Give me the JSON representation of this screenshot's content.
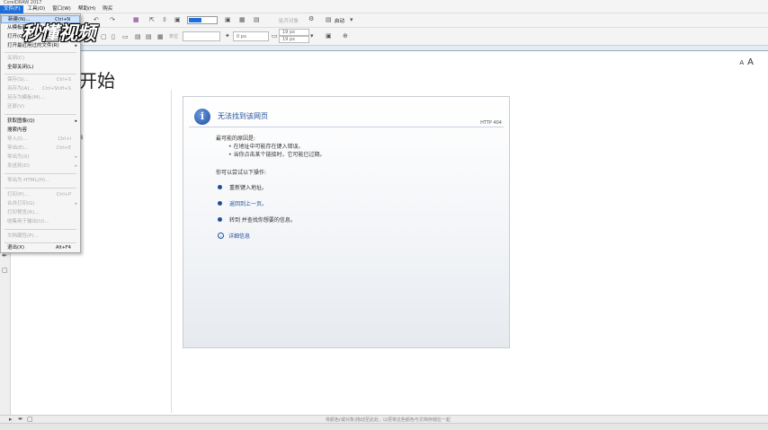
{
  "app": {
    "title": "CorelDRAW 2017"
  },
  "menubar": {
    "items": [
      "文件(F)",
      "工具(O)",
      "窗口(W)",
      "帮助(H)",
      "购买"
    ]
  },
  "toolbar": {
    "zoom_label": "启动",
    "x_value": "0 px",
    "nudge_x": "19 px",
    "nudge_y": "19 px",
    "unit_label": "单位",
    "snap_label": "贴齐对象"
  },
  "watermark": "秒懂视频",
  "page": {
    "title": "开始",
    "partial_text": "档",
    "font_small": "A",
    "font_large": "A"
  },
  "error": {
    "title": "无法找到该网页",
    "code": "HTTP 404",
    "causes_heading": "最可能的原因是:",
    "causes": [
      "在地址中可能存在键入错误。",
      "当你点击某个链接时，它可能已过期。"
    ],
    "actions_heading": "你可以尝试以下操作:",
    "actions": [
      "重新键入地址。",
      "返回到上一页。",
      "转到  并查找你想要的信息。"
    ],
    "details": "详细信息"
  },
  "filemenu": {
    "items": [
      {
        "label": "新建(N)...",
        "shortcut": "Ctrl+N",
        "enabled": true
      },
      {
        "label": "从模板新建(F)...",
        "shortcut": "",
        "enabled": true
      },
      {
        "label": "打开(O)...",
        "shortcut": "Ctrl+O",
        "enabled": true
      },
      {
        "label": "打开最近用过的文件(R)",
        "shortcut": "",
        "enabled": true
      },
      {
        "label": "关闭(C)",
        "shortcut": "",
        "enabled": false
      },
      {
        "label": "全部关闭(L)",
        "shortcut": "",
        "enabled": true
      },
      {
        "label": "保存(S)...",
        "shortcut": "Ctrl+S",
        "enabled": false
      },
      {
        "label": "另存为(A)...",
        "shortcut": "Ctrl+Shift+S",
        "enabled": false
      },
      {
        "label": "另存为模板(M)...",
        "shortcut": "",
        "enabled": false
      },
      {
        "label": "还原(V)",
        "shortcut": "",
        "enabled": false
      },
      {
        "label": "获取图像(Q)",
        "shortcut": "",
        "enabled": true
      },
      {
        "label": "搜索内容",
        "shortcut": "",
        "enabled": true
      },
      {
        "label": "导入(I)...",
        "shortcut": "Ctrl+I",
        "enabled": false
      },
      {
        "label": "导出(E)...",
        "shortcut": "Ctrl+E",
        "enabled": false
      },
      {
        "label": "导出为(X)",
        "shortcut": "",
        "enabled": false
      },
      {
        "label": "发送到(D)",
        "shortcut": "",
        "enabled": false
      },
      {
        "label": "导出为 HTML(H)...",
        "shortcut": "",
        "enabled": false
      },
      {
        "label": "打印(P)...",
        "shortcut": "Ctrl+P",
        "enabled": false
      },
      {
        "label": "合并打印(G)",
        "shortcut": "",
        "enabled": false
      },
      {
        "label": "打印预览(R)...",
        "shortcut": "",
        "enabled": false
      },
      {
        "label": "收集用于输出(U)...",
        "shortcut": "",
        "enabled": false
      },
      {
        "label": "文档属性(P)...",
        "shortcut": "",
        "enabled": false
      },
      {
        "label": "退出(X)",
        "shortcut": "Alt+F4",
        "enabled": true
      }
    ]
  },
  "status": {
    "hint": "将颜色(或对象)拖动至此处，以便将这些颜色与文档存储在一起"
  }
}
